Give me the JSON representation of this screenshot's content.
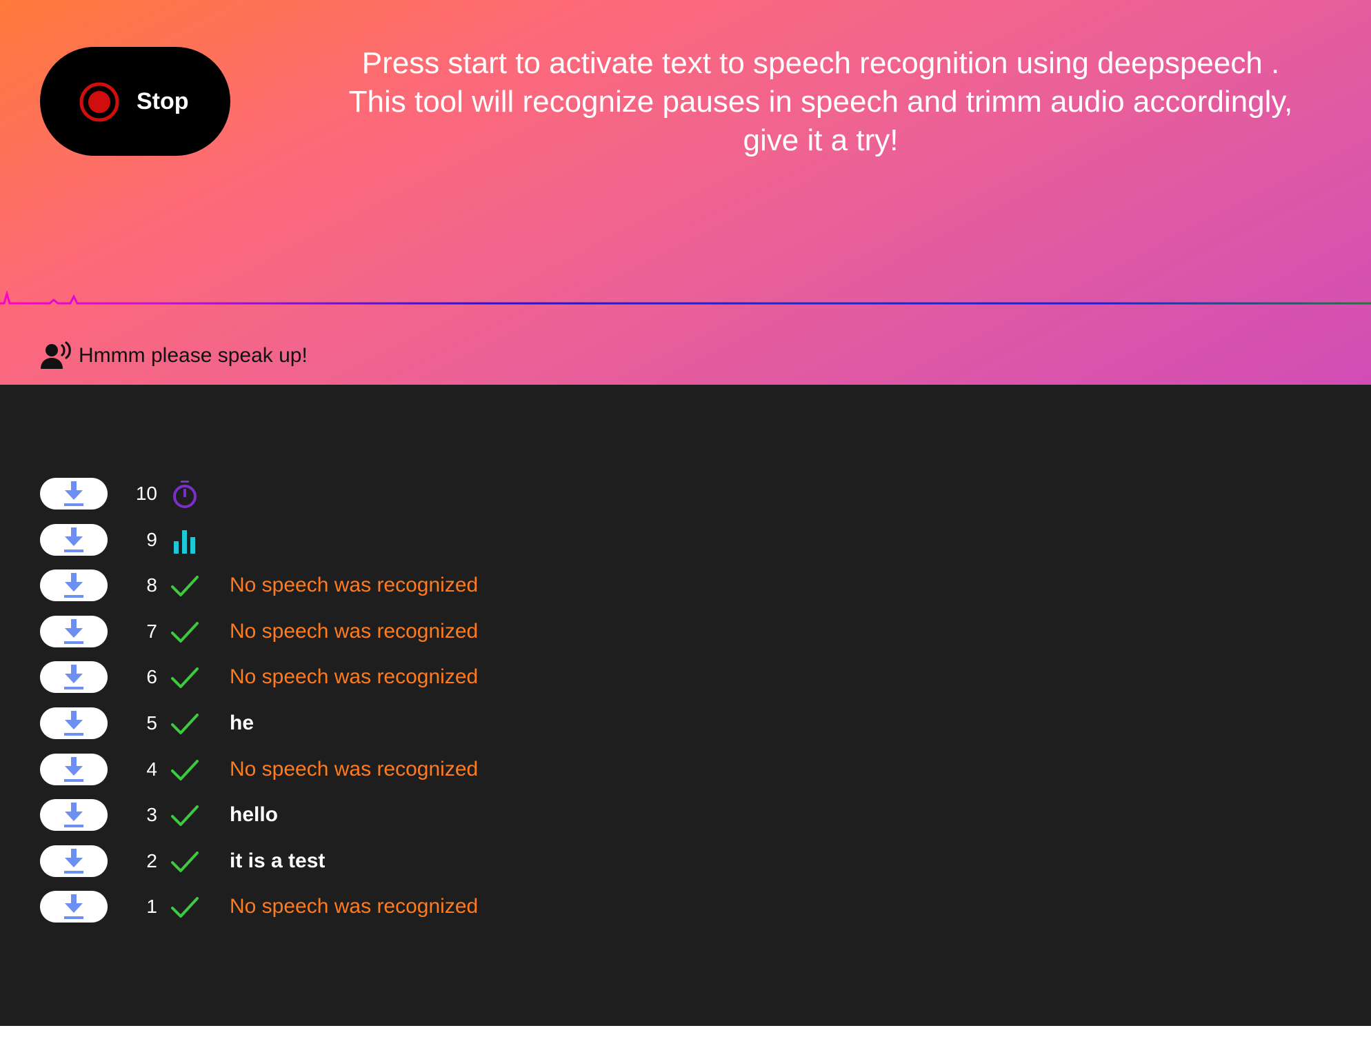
{
  "controls": {
    "record_label": "Stop"
  },
  "intro_lines": [
    "Press start to activate text to speech recognition using deepspeech .",
    "This tool will recognize pauses in speech and trimm audio accordingly,",
    "give it a try!"
  ],
  "status": {
    "icon": "voice-user-icon",
    "text": "Hmmm please speak up!"
  },
  "colors": {
    "gradient_start": "#ff7a3a",
    "gradient_end": "#d14db5",
    "panel_bg": "#1e1e1e",
    "no_speech": "#ff7b1f",
    "check": "#3ec940",
    "timer": "#7b2fc9",
    "analyzing": "#1ec8d6",
    "download_arrow": "#6e8ff2"
  },
  "recordings": [
    {
      "index": "10",
      "state": "timer-icon",
      "transcript": ""
    },
    {
      "index": "9",
      "state": "analyzing-icon",
      "transcript": ""
    },
    {
      "index": "8",
      "state": "check-icon",
      "transcript": "No speech was recognized"
    },
    {
      "index": "7",
      "state": "check-icon",
      "transcript": "No speech was recognized"
    },
    {
      "index": "6",
      "state": "check-icon",
      "transcript": "No speech was recognized"
    },
    {
      "index": "5",
      "state": "check-icon",
      "transcript": "he"
    },
    {
      "index": "4",
      "state": "check-icon",
      "transcript": "No speech was recognized"
    },
    {
      "index": "3",
      "state": "check-icon",
      "transcript": "hello"
    },
    {
      "index": "2",
      "state": "check-icon",
      "transcript": "it is a test"
    },
    {
      "index": "1",
      "state": "check-icon",
      "transcript": "No speech was recognized"
    }
  ]
}
